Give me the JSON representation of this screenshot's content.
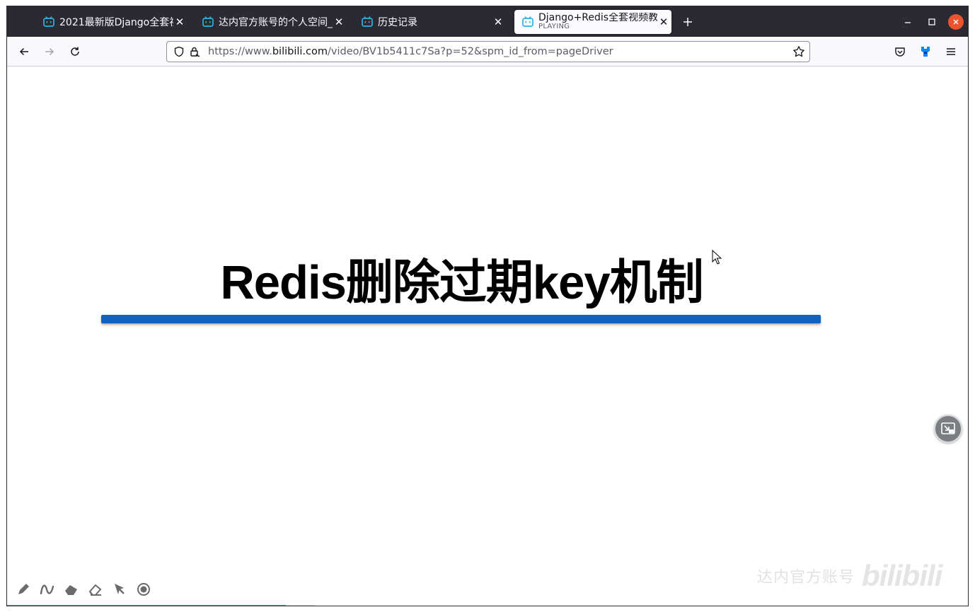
{
  "tabs": [
    {
      "title": "2021最新版Django全套视",
      "active": false
    },
    {
      "title": "达内官方账号的个人空间_",
      "active": false
    },
    {
      "title": "历史记录",
      "active": false
    },
    {
      "title": "Django+Redis全套视频教",
      "subtitle": "PLAYING",
      "active": true
    }
  ],
  "navbar": {
    "url_prefix": "https://www.",
    "url_host": "bilibili.com",
    "url_path": "/video/BV1b5411c7Sa?p=52&spm_id_from=pageDriver"
  },
  "slide": {
    "title": "Redis删除过期key机制"
  },
  "player": {
    "watermark_text": "达内官方账号",
    "watermark_logo": "bilibili",
    "progress_fraction": 0.29,
    "buffer_fraction": 0.32
  },
  "colors": {
    "tabbar": "#2b2a33",
    "accent_blue": "#1064bf",
    "bilibili_blue": "#23ade5",
    "close_red": "#e9542d"
  }
}
